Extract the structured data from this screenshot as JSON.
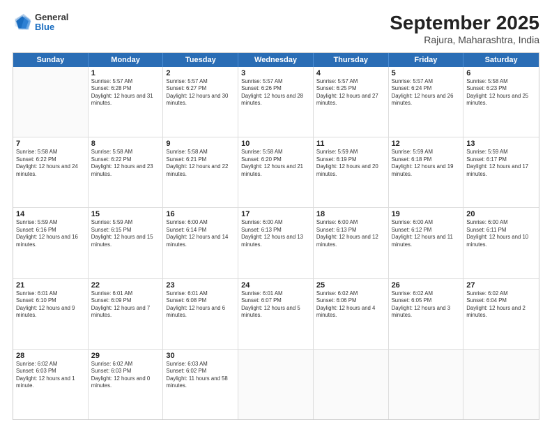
{
  "header": {
    "logo": {
      "general": "General",
      "blue": "Blue"
    },
    "title": "September 2025",
    "subtitle": "Rajura, Maharashtra, India"
  },
  "calendar": {
    "days_of_week": [
      "Sunday",
      "Monday",
      "Tuesday",
      "Wednesday",
      "Thursday",
      "Friday",
      "Saturday"
    ],
    "weeks": [
      [
        {
          "day": "",
          "empty": true
        },
        {
          "day": "1",
          "sunrise": "5:57 AM",
          "sunset": "6:28 PM",
          "daylight": "12 hours and 31 minutes."
        },
        {
          "day": "2",
          "sunrise": "5:57 AM",
          "sunset": "6:27 PM",
          "daylight": "12 hours and 30 minutes."
        },
        {
          "day": "3",
          "sunrise": "5:57 AM",
          "sunset": "6:26 PM",
          "daylight": "12 hours and 28 minutes."
        },
        {
          "day": "4",
          "sunrise": "5:57 AM",
          "sunset": "6:25 PM",
          "daylight": "12 hours and 27 minutes."
        },
        {
          "day": "5",
          "sunrise": "5:57 AM",
          "sunset": "6:24 PM",
          "daylight": "12 hours and 26 minutes."
        },
        {
          "day": "6",
          "sunrise": "5:58 AM",
          "sunset": "6:23 PM",
          "daylight": "12 hours and 25 minutes."
        }
      ],
      [
        {
          "day": "7",
          "sunrise": "5:58 AM",
          "sunset": "6:22 PM",
          "daylight": "12 hours and 24 minutes."
        },
        {
          "day": "8",
          "sunrise": "5:58 AM",
          "sunset": "6:22 PM",
          "daylight": "12 hours and 23 minutes."
        },
        {
          "day": "9",
          "sunrise": "5:58 AM",
          "sunset": "6:21 PM",
          "daylight": "12 hours and 22 minutes."
        },
        {
          "day": "10",
          "sunrise": "5:58 AM",
          "sunset": "6:20 PM",
          "daylight": "12 hours and 21 minutes."
        },
        {
          "day": "11",
          "sunrise": "5:59 AM",
          "sunset": "6:19 PM",
          "daylight": "12 hours and 20 minutes."
        },
        {
          "day": "12",
          "sunrise": "5:59 AM",
          "sunset": "6:18 PM",
          "daylight": "12 hours and 19 minutes."
        },
        {
          "day": "13",
          "sunrise": "5:59 AM",
          "sunset": "6:17 PM",
          "daylight": "12 hours and 17 minutes."
        }
      ],
      [
        {
          "day": "14",
          "sunrise": "5:59 AM",
          "sunset": "6:16 PM",
          "daylight": "12 hours and 16 minutes."
        },
        {
          "day": "15",
          "sunrise": "5:59 AM",
          "sunset": "6:15 PM",
          "daylight": "12 hours and 15 minutes."
        },
        {
          "day": "16",
          "sunrise": "6:00 AM",
          "sunset": "6:14 PM",
          "daylight": "12 hours and 14 minutes."
        },
        {
          "day": "17",
          "sunrise": "6:00 AM",
          "sunset": "6:13 PM",
          "daylight": "12 hours and 13 minutes."
        },
        {
          "day": "18",
          "sunrise": "6:00 AM",
          "sunset": "6:13 PM",
          "daylight": "12 hours and 12 minutes."
        },
        {
          "day": "19",
          "sunrise": "6:00 AM",
          "sunset": "6:12 PM",
          "daylight": "12 hours and 11 minutes."
        },
        {
          "day": "20",
          "sunrise": "6:00 AM",
          "sunset": "6:11 PM",
          "daylight": "12 hours and 10 minutes."
        }
      ],
      [
        {
          "day": "21",
          "sunrise": "6:01 AM",
          "sunset": "6:10 PM",
          "daylight": "12 hours and 9 minutes."
        },
        {
          "day": "22",
          "sunrise": "6:01 AM",
          "sunset": "6:09 PM",
          "daylight": "12 hours and 7 minutes."
        },
        {
          "day": "23",
          "sunrise": "6:01 AM",
          "sunset": "6:08 PM",
          "daylight": "12 hours and 6 minutes."
        },
        {
          "day": "24",
          "sunrise": "6:01 AM",
          "sunset": "6:07 PM",
          "daylight": "12 hours and 5 minutes."
        },
        {
          "day": "25",
          "sunrise": "6:02 AM",
          "sunset": "6:06 PM",
          "daylight": "12 hours and 4 minutes."
        },
        {
          "day": "26",
          "sunrise": "6:02 AM",
          "sunset": "6:05 PM",
          "daylight": "12 hours and 3 minutes."
        },
        {
          "day": "27",
          "sunrise": "6:02 AM",
          "sunset": "6:04 PM",
          "daylight": "12 hours and 2 minutes."
        }
      ],
      [
        {
          "day": "28",
          "sunrise": "6:02 AM",
          "sunset": "6:03 PM",
          "daylight": "12 hours and 1 minute."
        },
        {
          "day": "29",
          "sunrise": "6:02 AM",
          "sunset": "6:03 PM",
          "daylight": "12 hours and 0 minutes."
        },
        {
          "day": "30",
          "sunrise": "6:03 AM",
          "sunset": "6:02 PM",
          "daylight": "11 hours and 58 minutes."
        },
        {
          "day": "",
          "empty": true
        },
        {
          "day": "",
          "empty": true
        },
        {
          "day": "",
          "empty": true
        },
        {
          "day": "",
          "empty": true
        }
      ]
    ]
  }
}
